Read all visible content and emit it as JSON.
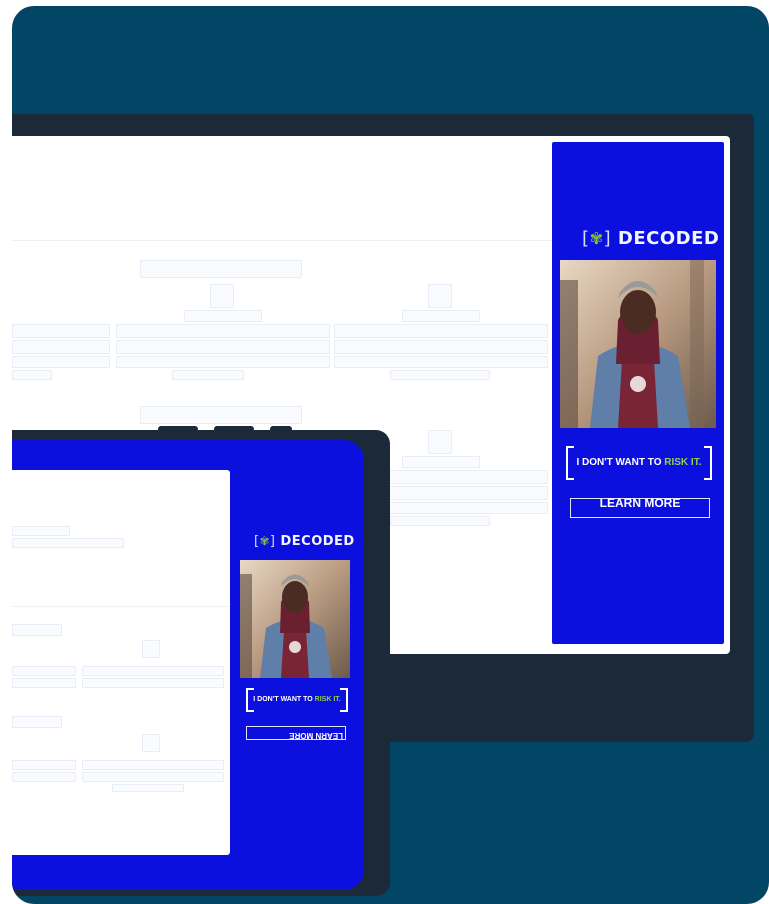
{
  "laptop_ad": {
    "brand_open": "[",
    "brand_leaf": "✾",
    "brand_close": "]",
    "brand_name": "DECODED",
    "tagline_prefix": "I DON'T WANT TO ",
    "tagline_highlight": "RISK IT.",
    "learn_more_label": "LEARN MORE"
  },
  "tablet_ad": {
    "brand_open": "[",
    "brand_leaf": "✾",
    "brand_close": "]",
    "brand_name": "DECODED",
    "tagline_prefix": "I DON'T WANT TO ",
    "tagline_highlight": "RISK IT.",
    "learn_more_label": "LEARN MORE"
  },
  "colors": {
    "card_background": "#034564",
    "ad_background": "#0c10de",
    "device_frame": "#1c2938",
    "highlight_green": "#8fd14f"
  }
}
